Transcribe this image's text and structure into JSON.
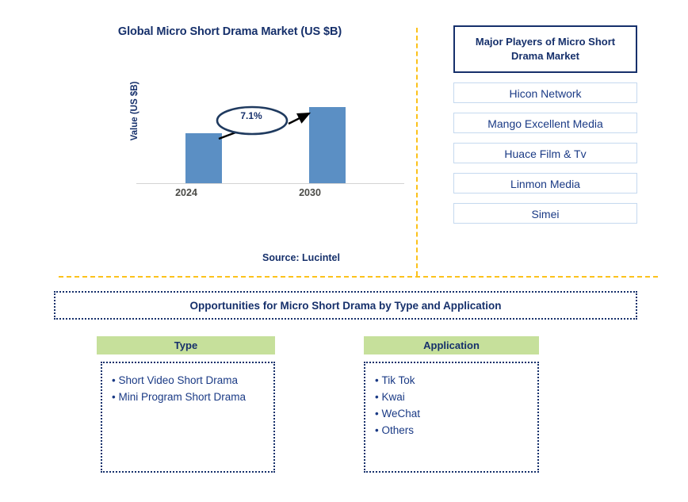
{
  "chart_panel": {
    "title": "Global Micro Short Drama Market (US $B)",
    "source": "Source: Lucintel"
  },
  "chart_data": {
    "type": "bar",
    "title": "Global Micro Short Drama Market (US $B)",
    "categories": [
      "2024",
      "2030"
    ],
    "values": [
      59,
      90
    ],
    "xlabel": "",
    "ylabel": "Value (US $B)",
    "ylim": [
      0,
      100
    ],
    "grid": false,
    "legend": false,
    "series": [
      {
        "name": "Value (US $B)",
        "values": [
          59,
          90
        ]
      }
    ],
    "annotations": [
      {
        "label": "7.1%",
        "type": "cagr-callout",
        "from": "2024",
        "to": "2030"
      }
    ],
    "bar_color": "#5b8fc4"
  },
  "players": {
    "header": "Major Players of Micro Short Drama Market",
    "items": [
      {
        "label": "Hicon Network"
      },
      {
        "label": "Mango Excellent Media"
      },
      {
        "label": "Huace Film & Tv"
      },
      {
        "label": "Linmon Media"
      },
      {
        "label": "Simei"
      }
    ]
  },
  "opportunities": {
    "banner": "Opportunities for Micro Short Drama by Type and Application",
    "columns": [
      {
        "header": "Type",
        "items": [
          "Short Video Short Drama",
          "Mini Program Short Drama"
        ]
      },
      {
        "header": "Application",
        "items": [
          "Tik Tok",
          "Kwai",
          "WeChat",
          "Others"
        ]
      }
    ]
  },
  "colors": {
    "navy": "#16306b",
    "bar_blue": "#5b8fc4",
    "divider_amber": "#fcc21b",
    "header_green": "#c6e09b",
    "link_blue": "#1a3a85"
  }
}
